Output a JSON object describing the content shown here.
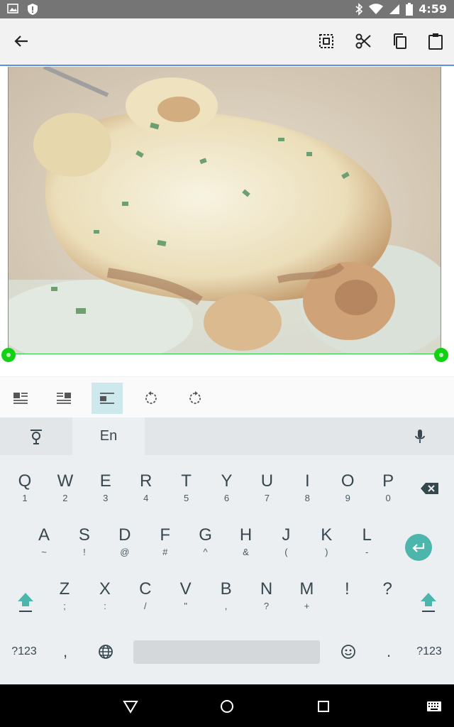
{
  "status_bar": {
    "time": "4:59",
    "icons": [
      "image-icon",
      "shield-icon",
      "bluetooth-icon",
      "wifi-icon",
      "signal-icon",
      "battery-icon"
    ]
  },
  "toolbar": {
    "back_icon": "arrow-left-icon",
    "actions": [
      "select-all-icon",
      "cut-icon",
      "copy-icon",
      "paste-icon"
    ],
    "accent_color": "#5c8fe6"
  },
  "image": {
    "selection_color": "#12d012"
  },
  "format_bar": {
    "buttons": [
      "wrap-left-icon",
      "wrap-right-icon",
      "inline-icon",
      "rotate-left-icon",
      "rotate-right-icon"
    ],
    "active_index": 2
  },
  "keyboard": {
    "language_tab": "En",
    "row1": [
      {
        "main": "Q",
        "sub": "1"
      },
      {
        "main": "W",
        "sub": "2"
      },
      {
        "main": "E",
        "sub": "3"
      },
      {
        "main": "R",
        "sub": "4"
      },
      {
        "main": "T",
        "sub": "5"
      },
      {
        "main": "Y",
        "sub": "6"
      },
      {
        "main": "U",
        "sub": "7"
      },
      {
        "main": "I",
        "sub": "8"
      },
      {
        "main": "O",
        "sub": "9"
      },
      {
        "main": "P",
        "sub": "0"
      }
    ],
    "row2": [
      {
        "main": "A",
        "sub": "~"
      },
      {
        "main": "S",
        "sub": "!"
      },
      {
        "main": "D",
        "sub": "@"
      },
      {
        "main": "F",
        "sub": "#"
      },
      {
        "main": "G",
        "sub": "^"
      },
      {
        "main": "H",
        "sub": "&"
      },
      {
        "main": "J",
        "sub": "("
      },
      {
        "main": "K",
        "sub": ")"
      },
      {
        "main": "L",
        "sub": "-"
      }
    ],
    "row3": [
      {
        "main": "Z",
        "sub": ";"
      },
      {
        "main": "X",
        "sub": ":"
      },
      {
        "main": "C",
        "sub": "/"
      },
      {
        "main": "V",
        "sub": "\""
      },
      {
        "main": "B",
        "sub": ","
      },
      {
        "main": "N",
        "sub": "?"
      },
      {
        "main": "M",
        "sub": "+"
      },
      {
        "main": "!",
        "sub": ""
      },
      {
        "main": "?",
        "sub": ""
      }
    ],
    "bottom": {
      "symbols_left": "?123",
      "comma": ",",
      "period": ".",
      "symbols_right": "?123"
    },
    "accent_color": "#4db6ac"
  },
  "nav_bar": {
    "buttons": [
      "back-triangle-icon",
      "home-circle-icon",
      "recents-square-icon",
      "keyboard-switch-icon"
    ]
  }
}
